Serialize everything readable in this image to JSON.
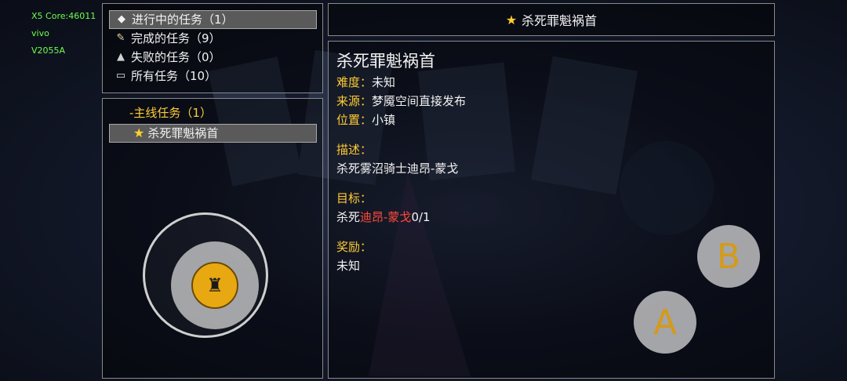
{
  "device_info": [
    "X5 Core:46011",
    "vivo",
    "V2055A"
  ],
  "categories": [
    {
      "icon": "ticket-icon",
      "glyph": "◆",
      "label": "进行中的任务（1）",
      "selected": true
    },
    {
      "icon": "scroll-icon",
      "glyph": "✎",
      "label": "完成的任务（9）",
      "selected": false
    },
    {
      "icon": "flask-icon",
      "glyph": "▲",
      "label": "失败的任务（0）",
      "selected": false
    },
    {
      "icon": "book-icon",
      "glyph": "▭",
      "label": "所有任务（10）",
      "selected": false
    }
  ],
  "quest_tree": {
    "group_label": "-主线任务（1）",
    "selected_item": "杀死罪魁祸首"
  },
  "detail": {
    "header_title": "杀死罪魁祸首",
    "name": "杀死罪魁祸首",
    "difficulty_label": "难度：",
    "difficulty_value": "未知",
    "source_label": "来源：",
    "source_value": "梦魇空间直接发布",
    "location_label": "位置：",
    "location_value": "小镇",
    "description_label": "描述：",
    "description_value": "杀死雾沼骑士迪昂-蒙戈",
    "objective_label": "目标：",
    "objective_prefix": "杀死",
    "objective_target": "迪昂-蒙戈",
    "objective_progress": "0/1",
    "reward_label": "奖励：",
    "reward_value": "未知"
  },
  "controls": {
    "button_b": "B",
    "button_a": "A"
  },
  "colors": {
    "label_yellow": "#ffcc33",
    "target_red": "#ff4a3a",
    "star_gold": "#ffcf2e"
  }
}
